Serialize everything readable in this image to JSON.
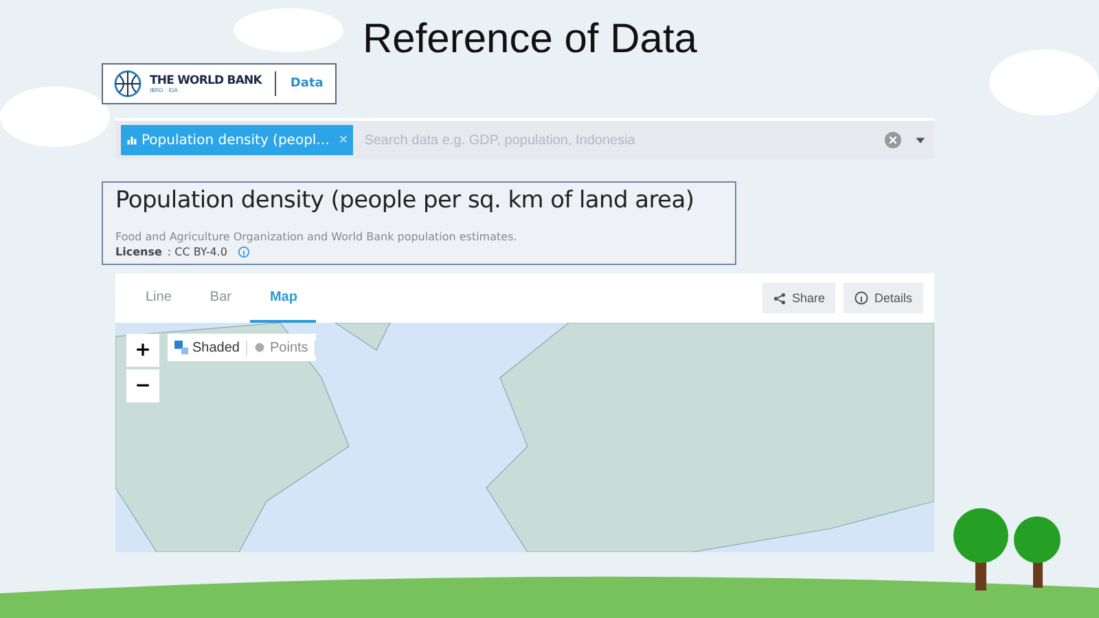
{
  "slide": {
    "title": "Reference of Data"
  },
  "logo": {
    "brand": "THE WORLD BANK",
    "sub": "IBRD · IDA",
    "section": "Data"
  },
  "search": {
    "chip": "Population density (peopl...",
    "chip_close": "×",
    "placeholder": "Search data e.g. GDP, population, Indonesia"
  },
  "indicator": {
    "title": "Population density (people per sq. km of land area)",
    "source": "Food and Agriculture Organization and World Bank population estimates.",
    "license_label": "License",
    "license_value": ": CC BY-4.0"
  },
  "tabs": [
    {
      "label": "Line",
      "selected": false
    },
    {
      "label": "Bar",
      "selected": false
    },
    {
      "label": "Map",
      "selected": true
    }
  ],
  "actions": [
    {
      "label": "Share",
      "kind": "share"
    },
    {
      "label": "Details",
      "kind": "info"
    }
  ],
  "map": {
    "zoom_in": "+",
    "zoom_out": "−",
    "modes": [
      {
        "label": "Shaded",
        "kind": "shaded",
        "selected": true
      },
      {
        "label": "Points",
        "kind": "points",
        "selected": false
      }
    ]
  }
}
